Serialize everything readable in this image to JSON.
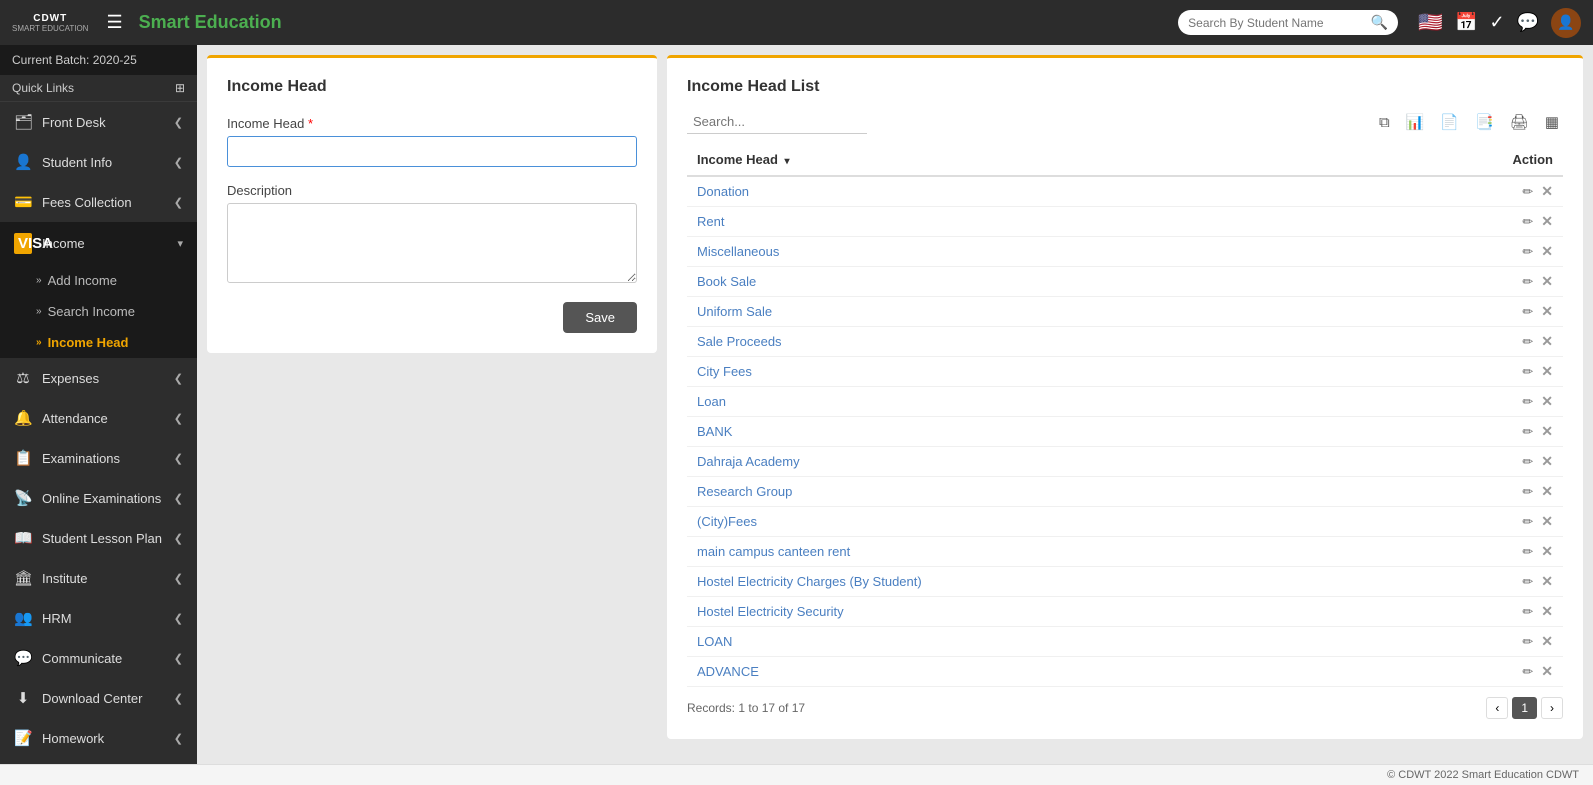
{
  "topbar": {
    "logo_line1": "CDWT",
    "logo_line2": "SMART EDUCATION",
    "hamburger": "☰",
    "title": "Smart Education",
    "search_placeholder": "Search By Student Name",
    "icons": {
      "flag": "🇺🇸",
      "calendar": "📅",
      "check": "✓",
      "whatsapp": "💬",
      "user": "👤"
    }
  },
  "sidebar": {
    "batch": "Current Batch: 2020-25",
    "quick_links_label": "Quick Links",
    "items": [
      {
        "id": "front-desk",
        "label": "Front Desk",
        "icon": "🗂",
        "has_chevron": true
      },
      {
        "id": "student-info",
        "label": "Student Info",
        "icon": "👤",
        "has_chevron": true
      },
      {
        "id": "fees-collection",
        "label": "Fees Collection",
        "icon": "💳",
        "has_chevron": true
      },
      {
        "id": "income",
        "label": "Income",
        "icon": "VISA",
        "has_chevron": true,
        "active": true,
        "subitems": [
          {
            "id": "add-income",
            "label": "Add Income",
            "active": false
          },
          {
            "id": "search-income",
            "label": "Search Income",
            "active": false
          },
          {
            "id": "income-head",
            "label": "Income Head",
            "active": true
          }
        ]
      },
      {
        "id": "expenses",
        "label": "Expenses",
        "icon": "📊",
        "has_chevron": true
      },
      {
        "id": "attendance",
        "label": "Attendance",
        "icon": "🔔",
        "has_chevron": true
      },
      {
        "id": "examinations",
        "label": "Examinations",
        "icon": "📋",
        "has_chevron": true
      },
      {
        "id": "online-examinations",
        "label": "Online Examinations",
        "icon": "📡",
        "has_chevron": true
      },
      {
        "id": "student-lesson-plan",
        "label": "Student Lesson Plan",
        "icon": "📖",
        "has_chevron": true
      },
      {
        "id": "institute",
        "label": "Institute",
        "icon": "🏛",
        "has_chevron": true
      },
      {
        "id": "hrm",
        "label": "HRM",
        "icon": "👥",
        "has_chevron": true
      },
      {
        "id": "communicate",
        "label": "Communicate",
        "icon": "💬",
        "has_chevron": true
      },
      {
        "id": "download-center",
        "label": "Download Center",
        "icon": "⬇",
        "has_chevron": true
      },
      {
        "id": "homework",
        "label": "Homework",
        "icon": "📝",
        "has_chevron": true
      }
    ]
  },
  "form": {
    "title": "Income Head",
    "income_head_label": "Income Head",
    "income_head_required": "*",
    "income_head_placeholder": "",
    "description_label": "Description",
    "description_placeholder": "",
    "save_button": "Save"
  },
  "list": {
    "title": "Income Head List",
    "search_placeholder": "Search...",
    "columns": [
      {
        "label": "Income Head",
        "sort": true
      },
      {
        "label": "Action"
      }
    ],
    "rows": [
      {
        "name": "Donation"
      },
      {
        "name": "Rent"
      },
      {
        "name": "Miscellaneous"
      },
      {
        "name": "Book Sale"
      },
      {
        "name": "Uniform Sale"
      },
      {
        "name": "Sale Proceeds"
      },
      {
        "name": "City Fees"
      },
      {
        "name": "Loan"
      },
      {
        "name": "BANK"
      },
      {
        "name": "Dahraja Academy"
      },
      {
        "name": "Research Group"
      },
      {
        "name": "(City)Fees"
      },
      {
        "name": "main campus canteen rent"
      },
      {
        "name": "Hostel Electricity Charges (By Student)"
      },
      {
        "name": "Hostel Electricity Security"
      },
      {
        "name": "LOAN"
      },
      {
        "name": "ADVANCE"
      }
    ],
    "records_label": "Records: 1 to 17 of 17",
    "page_current": "1"
  },
  "footer": {
    "copyright": "© CDWT 2022 Smart Education CDWT"
  }
}
